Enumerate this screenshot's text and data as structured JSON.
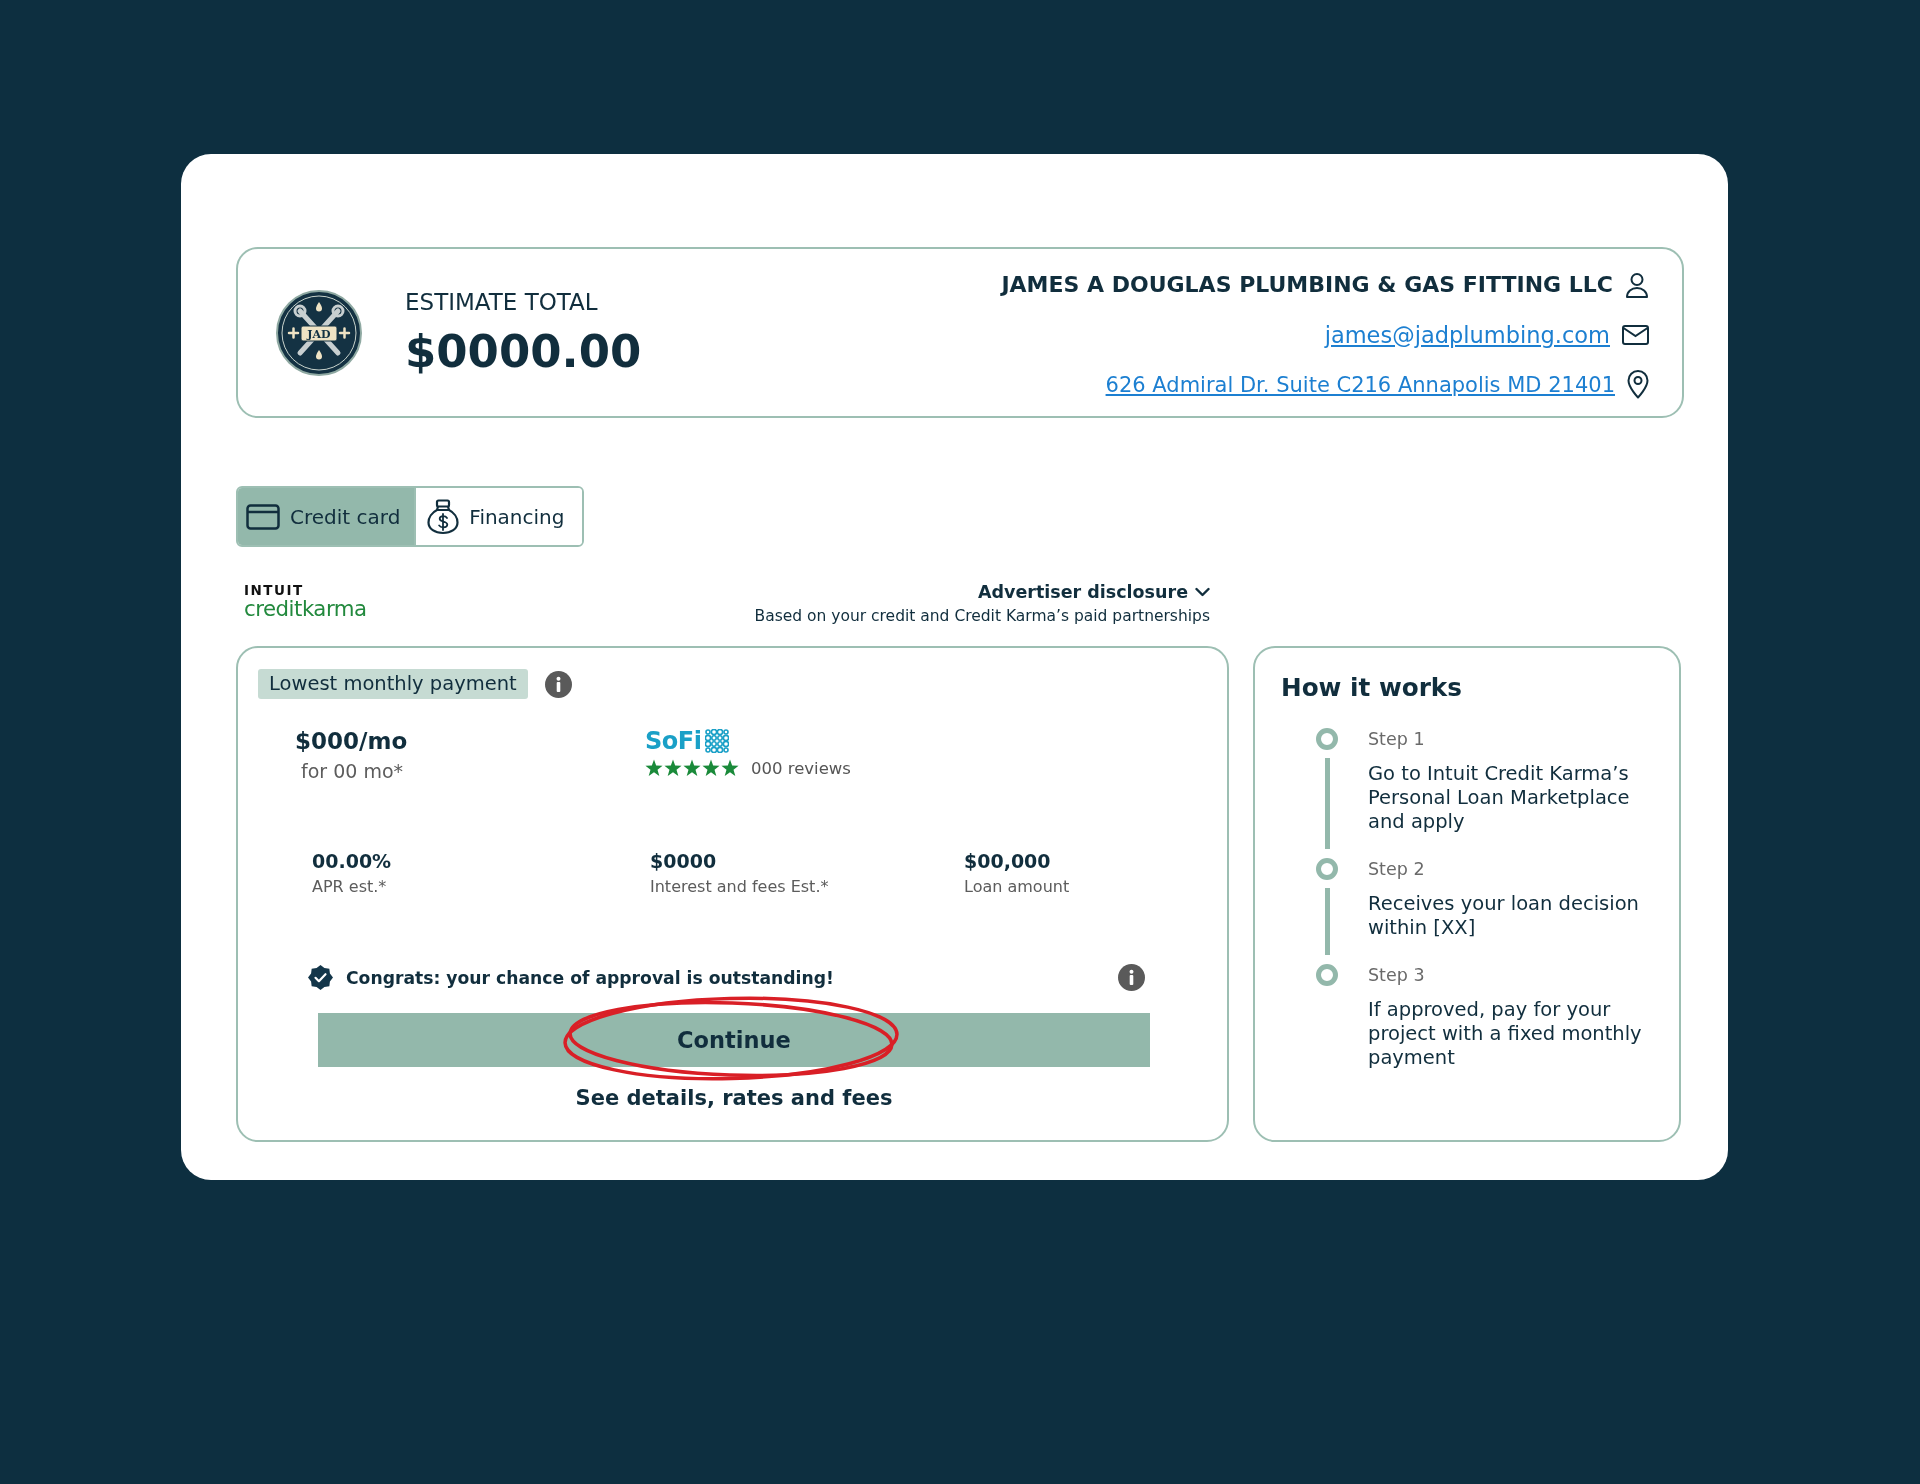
{
  "header": {
    "logo": {
      "monogram": "JAD"
    },
    "estimate": {
      "label": "ESTIMATE TOTAL",
      "amount": "$0000.00"
    },
    "business": {
      "name": "JAMES A DOUGLAS PLUMBING & GAS FITTING LLC",
      "email": "james@jadplumbing.com",
      "address": "626 Admiral Dr. Suite C216 Annapolis MD 21401"
    }
  },
  "payment_tabs": [
    {
      "label": "Credit card",
      "selected": true
    },
    {
      "label": "Financing",
      "selected": false
    }
  ],
  "provider": {
    "brand_small": "INTUIT",
    "brand_name": "creditkarma",
    "disclosure": {
      "label": "Advertiser disclosure",
      "expanded": false,
      "note": "Based on your credit and Credit Karma’s paid partnerships"
    }
  },
  "offer": {
    "badge": "Lowest monthly payment",
    "monthly_payment": "$000/mo",
    "term": "for 00 mo*",
    "lender": "SoFi",
    "stars": 5,
    "reviews": "000 reviews",
    "stats": [
      {
        "value": "00.00%",
        "label": "APR est.*"
      },
      {
        "value": "$0000",
        "label": "Interest and fees Est.*"
      },
      {
        "value": "$00,000",
        "label": "Loan amount"
      }
    ],
    "approval": "Congrats: your chance of approval is outstanding!",
    "button": "Continue",
    "details_link": "See details, rates and fees"
  },
  "how_it_works": {
    "title": "How it works",
    "steps": [
      {
        "label": "Step 1",
        "text": "Go to Intuit Credit Karma’s Personal Loan Marketplace and apply"
      },
      {
        "label": "Step 2",
        "text": "Receives your loan decision within [XX]"
      },
      {
        "label": "Step 3",
        "text": "If approved, pay for your project with a fixed monthly payment"
      }
    ]
  }
}
